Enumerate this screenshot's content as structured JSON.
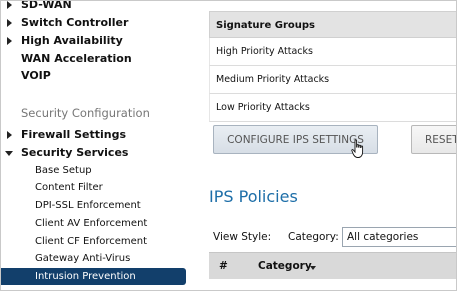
{
  "sidebar": {
    "top_items": [
      {
        "label": "SD-WAN",
        "arrow": "collapsed"
      },
      {
        "label": "Switch Controller",
        "arrow": "collapsed"
      },
      {
        "label": "High Availability",
        "arrow": "collapsed"
      },
      {
        "label": "WAN Acceleration",
        "arrow": "none"
      },
      {
        "label": "VOIP",
        "arrow": "none"
      }
    ],
    "section_title": "Security Configuration",
    "firewall_settings": "Firewall Settings",
    "security_services": "Security Services",
    "sub_items": [
      "Base Setup",
      "Content Filter",
      "DPI-SSL Enforcement",
      "Client AV Enforcement",
      "Client CF Enforcement",
      "Gateway Anti-Virus",
      "Intrusion Prevention"
    ],
    "active_item": "Intrusion Prevention"
  },
  "signature_groups": {
    "header": "Signature Groups",
    "rows": [
      "High Priority Attacks",
      "Medium Priority Attacks",
      "Low Priority Attacks"
    ]
  },
  "buttons": {
    "configure": "CONFIGURE IPS SETTINGS",
    "reset": "RESET"
  },
  "ips_policies": {
    "title": "IPS Policies",
    "view_style_label": "View Style:",
    "category_label": "Category:",
    "category_value": "All categories",
    "columns": [
      "#",
      "Category"
    ]
  },
  "colors": {
    "active_nav": "#123f6b",
    "title_blue": "#1d6ea8"
  }
}
